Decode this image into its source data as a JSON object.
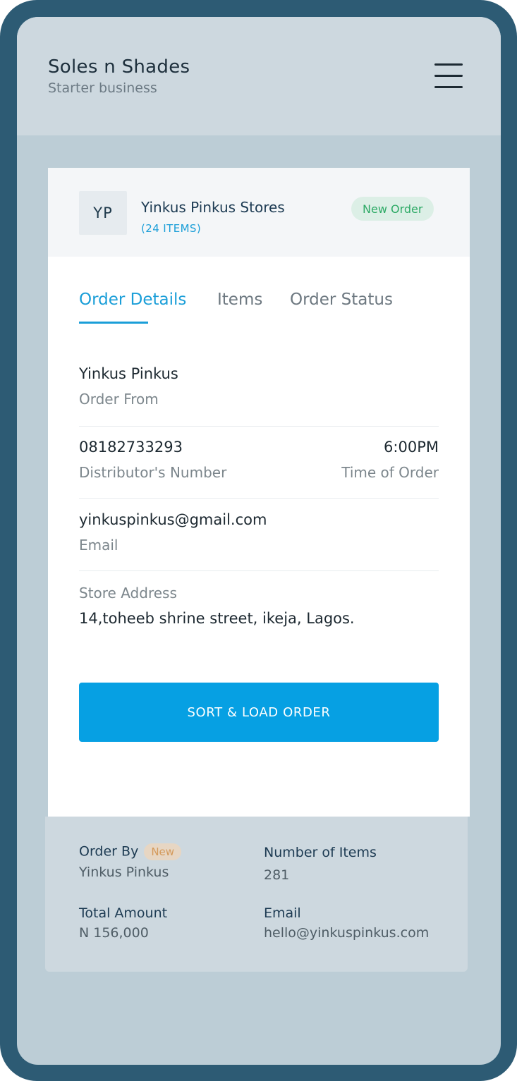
{
  "header": {
    "business_name": "Soles n Shades",
    "business_plan": "Starter business",
    "menu_icon": "hamburger-icon"
  },
  "store": {
    "initials": "YP",
    "name": "Yinkus Pinkus Stores",
    "items_count": "(24 ITEMS)",
    "badge": "New Order"
  },
  "tabs": [
    {
      "label": "Order Details",
      "active": true
    },
    {
      "label": "Items",
      "active": false
    },
    {
      "label": "Order Status",
      "active": false
    }
  ],
  "details": {
    "order_from_value": "Yinkus Pinkus",
    "order_from_label": "Order From",
    "distributor_number_value": "08182733293",
    "distributor_number_label": "Distributor's Number",
    "time_value": "6:00PM",
    "time_label": "Time of Order",
    "email_value": "yinkuspinkus@gmail.com",
    "email_label": "Email",
    "address_label": "Store Address",
    "address_value": "14,toheeb shrine street, ikeja, Lagos."
  },
  "action": {
    "sort_load_label": "SORT & LOAD ORDER"
  },
  "summary": {
    "order_by_title": "Order By",
    "order_by_badge": "New",
    "order_by_value": "Yinkus Pinkus",
    "items_title": "Number of Items",
    "items_value": "281",
    "total_title": "Total Amount",
    "total_value": "N 156,000",
    "email_title": "Email",
    "email_value": "hello@yinkuspinkus.com"
  },
  "colors": {
    "frame": "#2d5b74",
    "accent": "#06a0e3",
    "success": "#2eaa66",
    "warning": "#d49a5b"
  }
}
